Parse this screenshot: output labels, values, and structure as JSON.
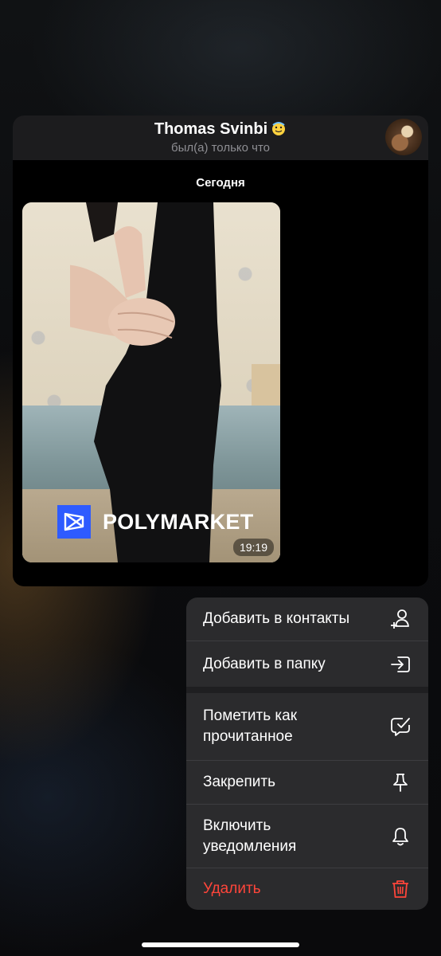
{
  "chat_header": {
    "contact_name": "Thomas Svinbi",
    "status": "был(а) только что"
  },
  "date_separator": "Сегодня",
  "photo_message": {
    "brand": "POLYMARKET",
    "time": "19:19"
  },
  "context_menu": {
    "items": [
      {
        "label": "Добавить в контакты",
        "icon": "add-contact-icon"
      },
      {
        "label": "Добавить в папку",
        "icon": "add-to-folder-icon"
      },
      {
        "label": "Пометить как\nпрочитанное",
        "icon": "mark-read-icon"
      },
      {
        "label": "Закрепить",
        "icon": "pin-icon"
      },
      {
        "label": "Включить\nуведомления",
        "icon": "bell-icon"
      },
      {
        "label": "Удалить",
        "icon": "trash-icon",
        "color": "#ff453a"
      }
    ]
  },
  "colors": {
    "menu_background": "#2b2b2d",
    "danger": "#ff453a",
    "brand_logo": "#2e5bff"
  }
}
